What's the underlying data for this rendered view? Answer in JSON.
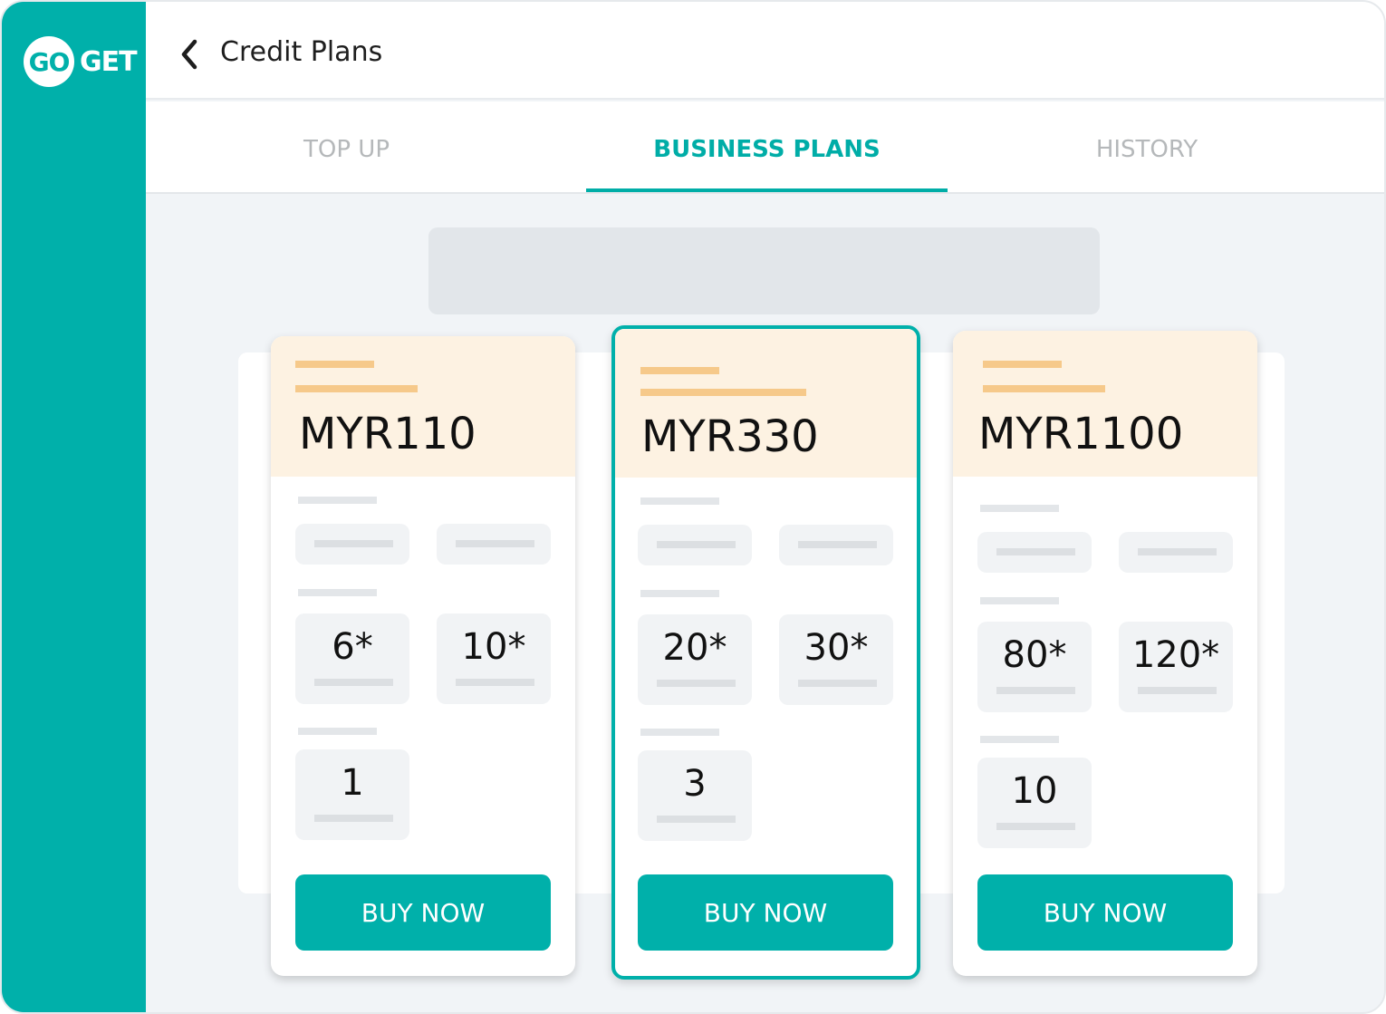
{
  "logo": {
    "badge_text": "GO",
    "text": "GET"
  },
  "header": {
    "title": "Credit Plans",
    "back_icon": "chevron-left-icon"
  },
  "tabs": [
    {
      "label": "TOP UP",
      "active": false
    },
    {
      "label": "BUSINESS PLANS",
      "active": true
    },
    {
      "label": "HISTORY",
      "active": false
    }
  ],
  "colors": {
    "brand": "#00b0aa",
    "card_header": "#fdf2e2",
    "accent_line": "#f6c98a"
  },
  "plans": [
    {
      "price": "MYR110",
      "value_a": "6*",
      "value_b": "10*",
      "value_c": "1",
      "button": "BUY NOW",
      "selected": false
    },
    {
      "price": "MYR330",
      "value_a": "20*",
      "value_b": "30*",
      "value_c": "3",
      "button": "BUY NOW",
      "selected": true
    },
    {
      "price": "MYR1100",
      "value_a": "80*",
      "value_b": "120*",
      "value_c": "10",
      "button": "BUY NOW",
      "selected": false
    }
  ]
}
